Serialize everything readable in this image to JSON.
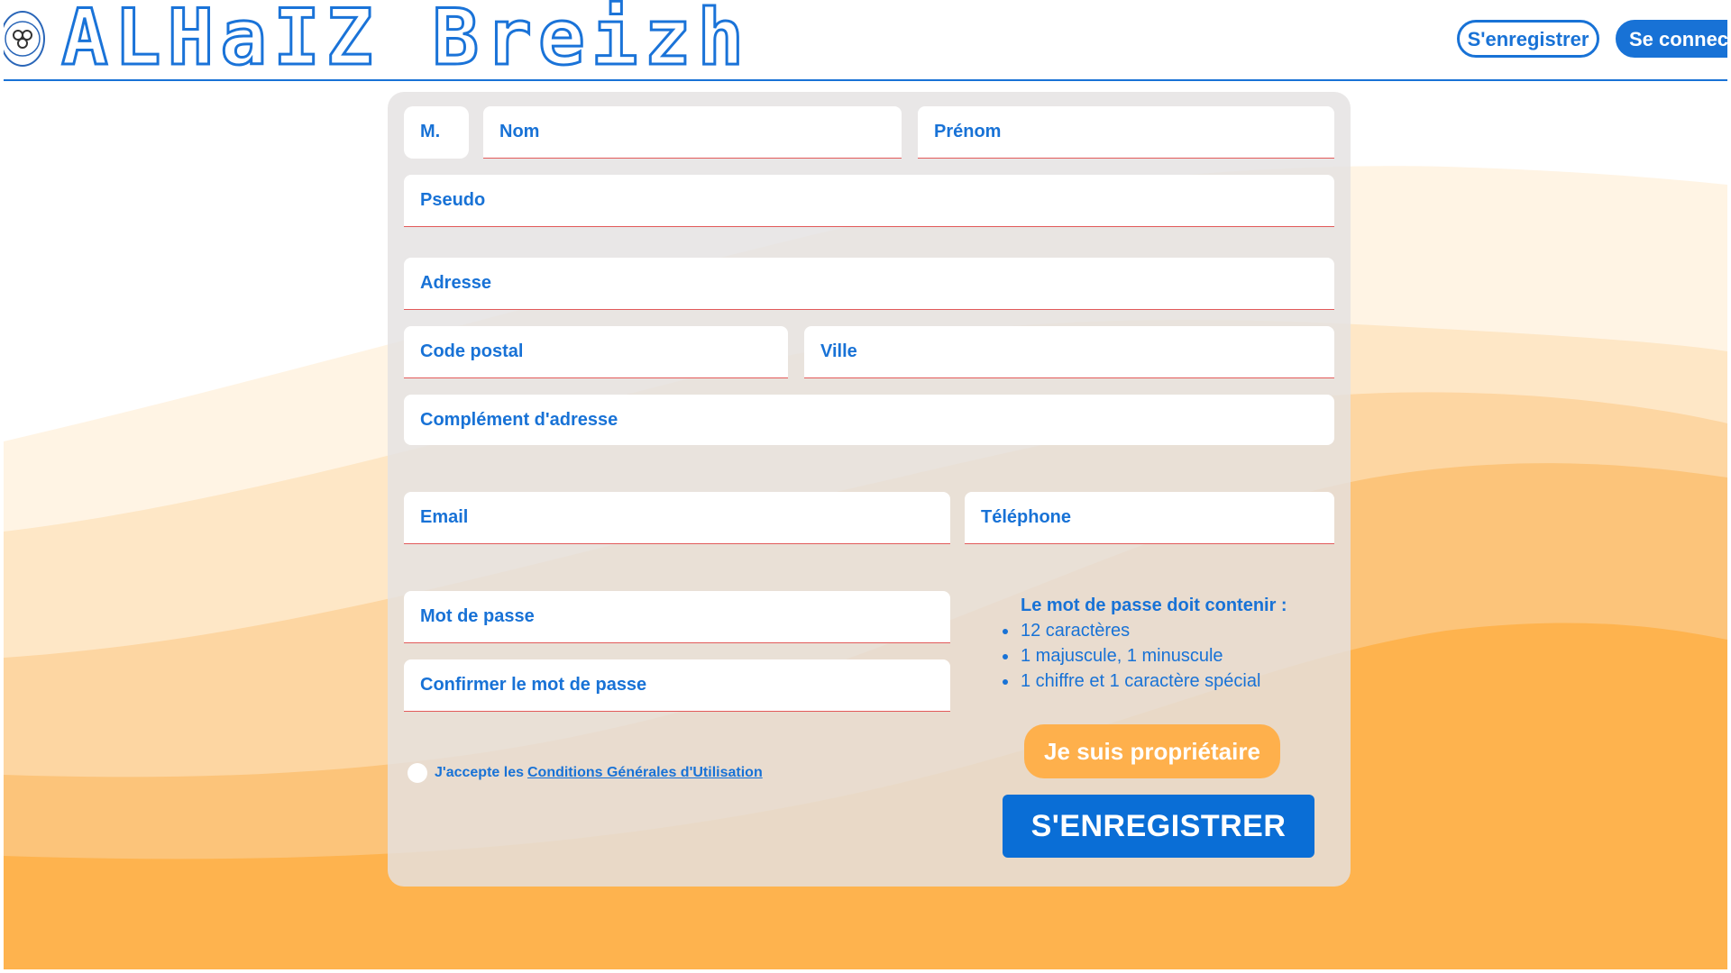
{
  "header": {
    "brand": "ALHaIZ Breizh",
    "register_label": "S'enregistrer",
    "login_label": "Se connecter"
  },
  "form": {
    "civility": "M.",
    "nom_placeholder": "Nom",
    "prenom_placeholder": "Prénom",
    "pseudo_placeholder": "Pseudo",
    "adresse_placeholder": "Adresse",
    "code_postal_placeholder": "Code postal",
    "ville_placeholder": "Ville",
    "complement_placeholder": "Complément d'adresse",
    "email_placeholder": "Email",
    "telephone_placeholder": "Téléphone",
    "password_placeholder": "Mot de passe",
    "confirm_password_placeholder": "Confirmer le mot de passe",
    "password_rules": {
      "title": "Le mot de passe doit contenir :",
      "items": [
        "12 caractères",
        "1 majuscule, 1 minuscule",
        "1 chiffre et 1 caractère spécial"
      ]
    },
    "cgu_text": "J'accepte les",
    "cgu_link": "Conditions Générales d'Utilisation",
    "owner_button": "Je suis propriétaire",
    "submit_button": "S'ENREGISTRER"
  },
  "colors": {
    "accent": "#1872d6",
    "field_underline": "#e25a5a",
    "owner_button": "#feb04c",
    "submit_button": "#0a6ed6"
  }
}
